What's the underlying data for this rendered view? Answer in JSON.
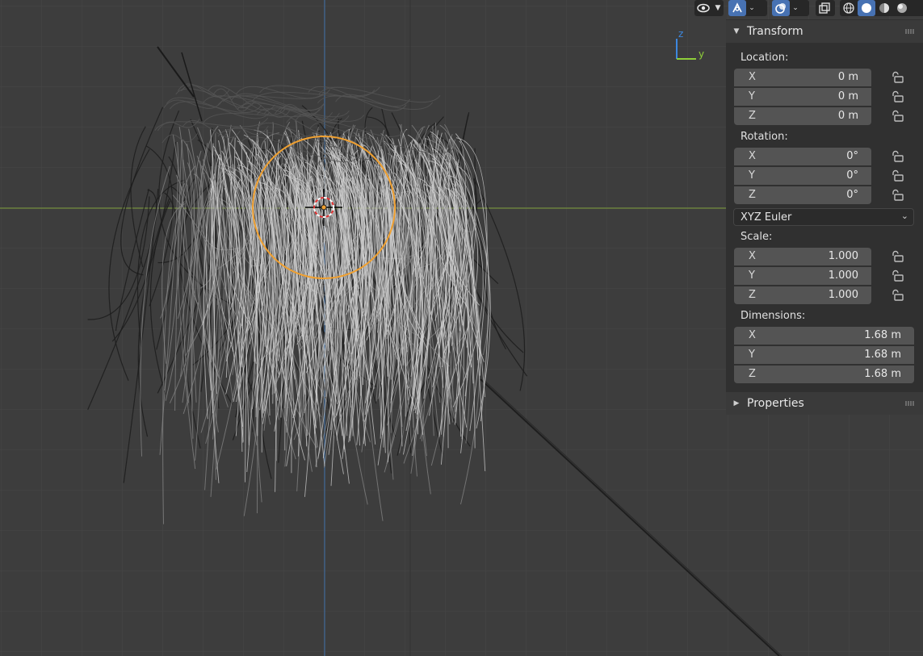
{
  "viewport": {
    "gizmo_axis_z": "z",
    "gizmo_axis_y": "y"
  },
  "toolbar": {
    "icons": [
      "visibility-icon",
      "gizmo-icon",
      "overlay-icon",
      "xray-icon",
      "wireframe-shading-icon",
      "solid-shading-icon",
      "material-shading-icon",
      "rendered-shading-icon"
    ]
  },
  "npanel": {
    "transform_title": "Transform",
    "location_label": "Location:",
    "location": [
      {
        "axis": "X",
        "value": "0 m"
      },
      {
        "axis": "Y",
        "value": "0 m"
      },
      {
        "axis": "Z",
        "value": "0 m"
      }
    ],
    "rotation_label": "Rotation:",
    "rotation": [
      {
        "axis": "X",
        "value": "0°"
      },
      {
        "axis": "Y",
        "value": "0°"
      },
      {
        "axis": "Z",
        "value": "0°"
      }
    ],
    "rotation_mode": "XYZ Euler",
    "scale_label": "Scale:",
    "scale": [
      {
        "axis": "X",
        "value": "1.000"
      },
      {
        "axis": "Y",
        "value": "1.000"
      },
      {
        "axis": "Z",
        "value": "1.000"
      }
    ],
    "dimensions_label": "Dimensions:",
    "dimensions": [
      {
        "axis": "X",
        "value": "1.68 m"
      },
      {
        "axis": "Y",
        "value": "1.68 m"
      },
      {
        "axis": "Z",
        "value": "1.68 m"
      }
    ],
    "properties_title": "Properties"
  },
  "colors": {
    "background": "#3d3d3d",
    "grid": "#464646",
    "x_axis": "#7f9e3a",
    "y_axis": "#3d6fa8",
    "selection": "#f0a030",
    "accent": "#4772b3"
  }
}
